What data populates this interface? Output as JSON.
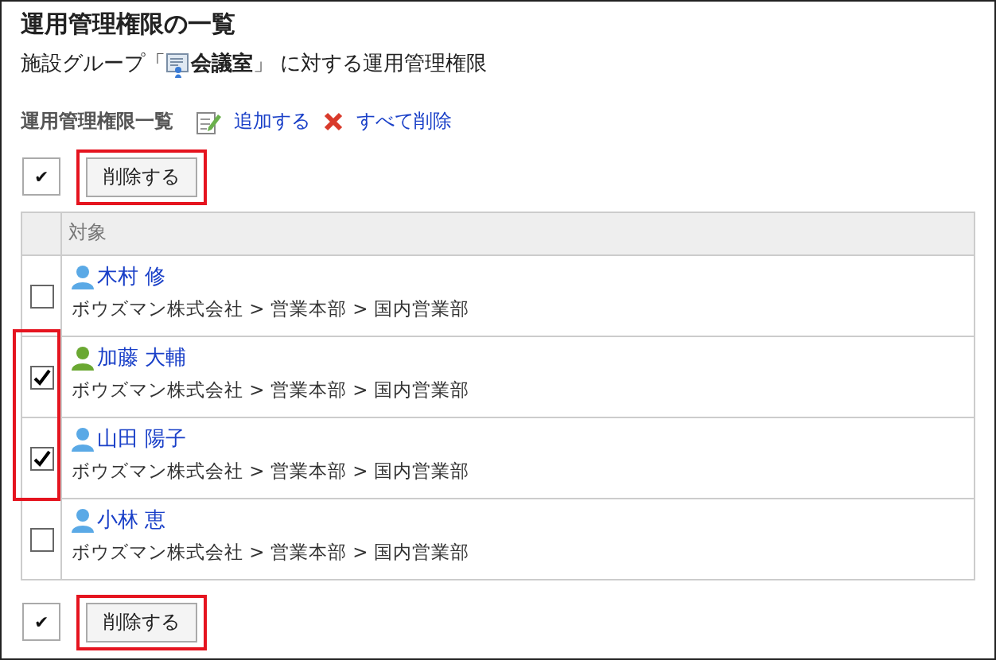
{
  "title": "運用管理権限の一覧",
  "subtitle": {
    "before": "施設グループ「",
    "group": "会議室",
    "after": "」 に対する運用管理権限"
  },
  "toolbar": {
    "label": "運用管理権限一覧",
    "add": "追加する",
    "delete_all": "すべて削除"
  },
  "top_actions": {
    "toggle": "✔",
    "button": "削除する",
    "highlighted": true
  },
  "table": {
    "columns": [
      "対象"
    ],
    "rows": [
      {
        "name": "木村 修",
        "path": "ボウズマン株式会社 > 営業本部 > 国内営業部",
        "checked": false,
        "color": "#5aa9e6",
        "highlighted": false
      },
      {
        "name": "加藤 大輔",
        "path": "ボウズマン株式会社 > 営業本部 > 国内営業部",
        "checked": true,
        "color": "#6aa832",
        "highlighted": true
      },
      {
        "name": "山田 陽子",
        "path": "ボウズマン株式会社 > 営業本部 > 国内営業部",
        "checked": true,
        "color": "#5aa9e6",
        "highlighted": true
      },
      {
        "name": "小林 恵",
        "path": "ボウズマン株式会社 > 営業本部 > 国内営業部",
        "checked": false,
        "color": "#5aa9e6",
        "highlighted": false
      }
    ]
  },
  "bottom_actions": {
    "toggle": "✔",
    "button": "削除する",
    "highlighted": true
  }
}
